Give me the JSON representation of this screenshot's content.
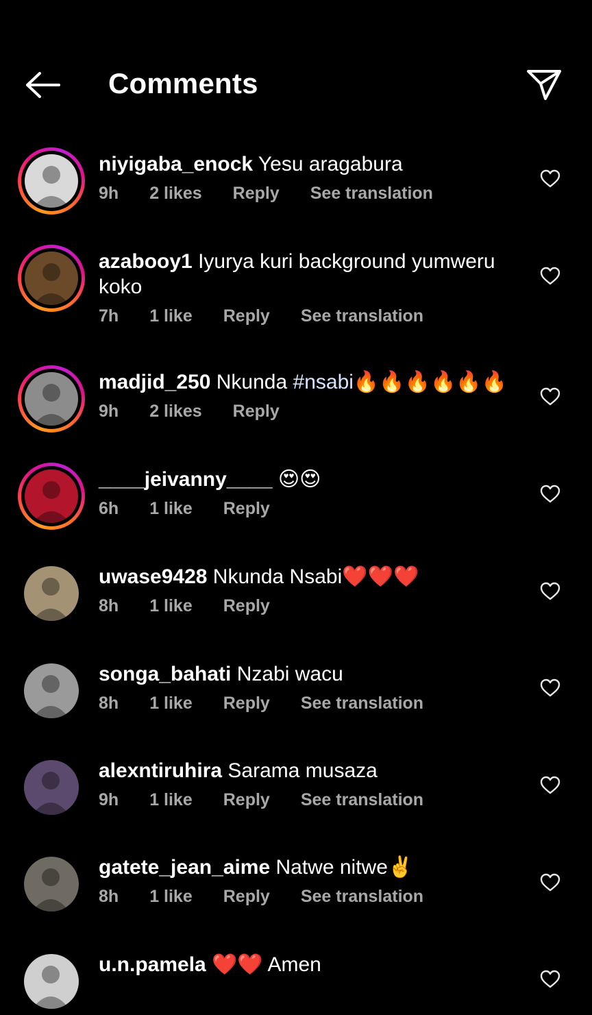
{
  "header": {
    "title": "Comments",
    "back_icon": "arrow-left-icon",
    "share_icon": "paper-plane-icon"
  },
  "comments": [
    {
      "user": "niyigaba_enock",
      "text": "Yesu aragabura",
      "time": "9h",
      "likes": "2 likes",
      "reply": "Reply",
      "translate": "See translation",
      "story_ring": true,
      "avatar_tone": "#d9d9d9"
    },
    {
      "user": "azabooy1",
      "text": "Iyurya kuri background yumweru koko",
      "time": "7h",
      "likes": "1 like",
      "reply": "Reply",
      "translate": "See translation",
      "story_ring": true,
      "avatar_tone": "#6b4a2a"
    },
    {
      "user": "madjid_250",
      "text_pre": "Nkunda ",
      "hashtag": "#nsabi",
      "emoji": "🔥🔥🔥🔥🔥🔥",
      "time": "9h",
      "likes": "2 likes",
      "reply": "Reply",
      "story_ring": true,
      "avatar_tone": "#8c8c8c"
    },
    {
      "user": "____jeivanny____",
      "emoji": "😍😍",
      "time": "6h",
      "likes": "1 like",
      "reply": "Reply",
      "story_ring": true,
      "avatar_tone": "#b3162c"
    },
    {
      "user": "uwase9428",
      "text": "Nkunda Nsabi",
      "emoji": "❤️❤️❤️",
      "time": "8h",
      "likes": "1 like",
      "reply": "Reply",
      "story_ring": false,
      "avatar_tone": "#a39273"
    },
    {
      "user": "songa_bahati",
      "text": "Nzabi wacu",
      "time": "8h",
      "likes": "1 like",
      "reply": "Reply",
      "translate": "See translation",
      "story_ring": false,
      "avatar_tone": "#9a9a9a"
    },
    {
      "user": "alexntiruhira",
      "text": "Sarama musaza",
      "time": "9h",
      "likes": "1 like",
      "reply": "Reply",
      "translate": "See translation",
      "story_ring": false,
      "avatar_tone": "#5c4a6e"
    },
    {
      "user": "gatete_jean_aime",
      "text": "Natwe nitwe",
      "emoji": "✌️",
      "time": "8h",
      "likes": "1 like",
      "reply": "Reply",
      "translate": "See translation",
      "story_ring": false,
      "avatar_tone": "#6f6a62"
    },
    {
      "user": "u.n.pamela",
      "emoji": "❤️❤️",
      "text_after": "Amen",
      "story_ring": false,
      "avatar_tone": "#cfcfcf"
    }
  ]
}
